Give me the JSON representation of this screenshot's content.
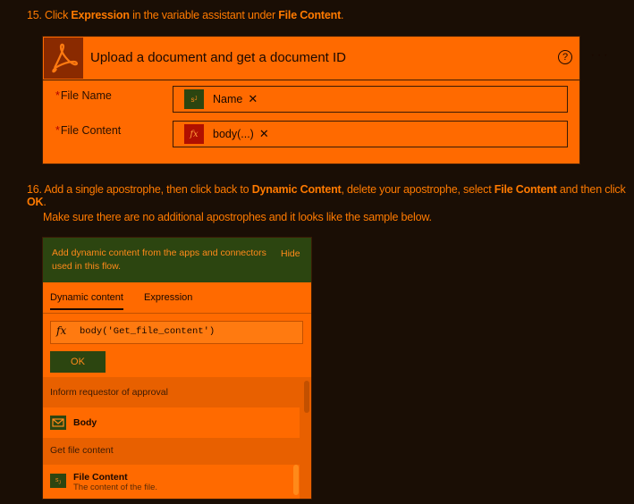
{
  "step15": {
    "prefix": "15. Click ",
    "bold1": "Expression",
    "mid": " in the variable assistant under ",
    "bold2": "File Content",
    "suffix": "."
  },
  "card": {
    "title": "Upload a document and get a document ID",
    "help": "?",
    "more": "···",
    "fields": [
      {
        "required": "*",
        "label": "File Name",
        "token_icon": "string-icon",
        "token": "Name",
        "remove": "✕"
      },
      {
        "required": "*",
        "label": "File Content",
        "token_icon": "fx-icon",
        "token_icon_text": "fx",
        "token": "body(...)",
        "remove": "✕"
      }
    ]
  },
  "step16": {
    "prefix": "16. Add a single apostrophe, then click back to ",
    "bold1": "Dynamic Content",
    "mid": ", delete your apostrophe, select ",
    "bold2": "File Content",
    "mid2": " and then click ",
    "bold3": "OK",
    "suffix": ".",
    "note": "Make sure there are no additional apostrophes and it looks like the sample below."
  },
  "panel": {
    "message": "Add dynamic content from the apps and connectors used in this flow.",
    "hide": "Hide",
    "tabs": [
      "Dynamic content",
      "Expression"
    ],
    "fx": "fx",
    "expression": "body('Get_file_content')",
    "ok": "OK",
    "groups": [
      {
        "name": "Inform requestor of approval",
        "items": [
          {
            "name": "Body",
            "icon": "mail-icon",
            "desc": ""
          }
        ]
      },
      {
        "name": "Get file content",
        "items": [
          {
            "name": "File Content",
            "icon": "string-icon",
            "desc": "The content of the file."
          }
        ]
      }
    ]
  },
  "colors": {
    "background": "#1a0e05",
    "accent": "#ff6a00",
    "text": "#ff7a00",
    "panel_header": "#2c4510",
    "logo_bg": "#8a2a00"
  }
}
